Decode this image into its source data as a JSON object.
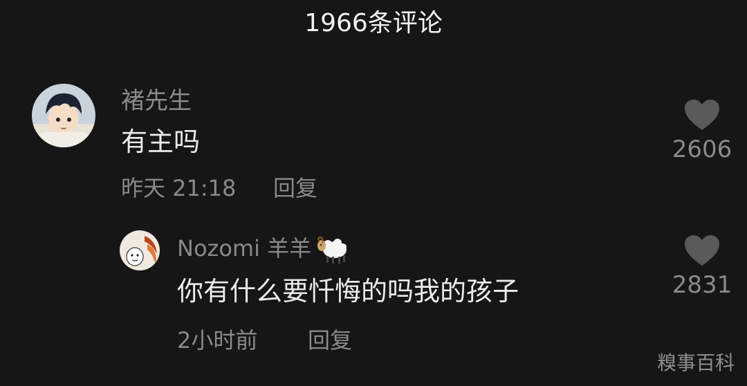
{
  "header": {
    "title": "1966条评论"
  },
  "comments": [
    {
      "username": "褚先生",
      "text": "有主吗",
      "time": "昨天 21:18",
      "reply_label": "回复",
      "likes": "2606",
      "avatar_icon": "anime-boy-avatar-icon"
    },
    {
      "username": "Nozomi 羊羊",
      "username_emoji": "sheep-emoji-icon",
      "text": "你有什么要忏悔的吗我的孩子",
      "time": "2小时前",
      "reply_label": "回复",
      "likes": "2831",
      "avatar_icon": "meme-face-avatar-icon"
    }
  ],
  "watermark": "糗事百科",
  "colors": {
    "background": "#161616",
    "text_primary": "#ececec",
    "text_secondary": "#8a8a8a",
    "heart": "#5a5a5a"
  }
}
